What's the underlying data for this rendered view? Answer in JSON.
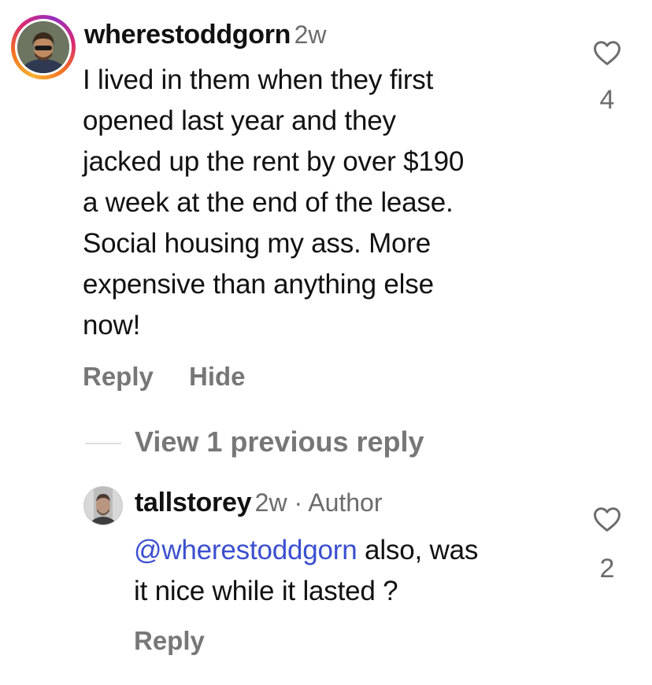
{
  "comment": {
    "username": "wherestoddgorn",
    "time": "2w",
    "text_lines": [
      "I lived in them when they first",
      "opened last year and they",
      "jacked up the rent by over $190",
      "a week at the end of the lease.",
      "Social housing my ass. More",
      "expensive than anything else",
      "now!"
    ],
    "actions": {
      "reply": "Reply",
      "hide": "Hide"
    },
    "likes": "4",
    "icons": {
      "avatar": "user-avatar",
      "like": "heart-outline-icon"
    }
  },
  "view_replies": {
    "label": "View 1 previous reply"
  },
  "reply": {
    "username": "tallstorey",
    "time": "2w",
    "separator": " · ",
    "badge": "Author",
    "mention": "@wherestoddgorn",
    "text_line1_rest": " also, was",
    "text_line2": "it nice while it lasted ?",
    "actions": {
      "reply": "Reply"
    },
    "likes": "2",
    "icons": {
      "avatar": "user-avatar",
      "like": "heart-outline-icon"
    }
  },
  "colors": {
    "text": "#111111",
    "secondary": "#6b6b6b",
    "action": "#777777",
    "mention": "#3b4fd0",
    "story_ring": [
      "#f9b233",
      "#f37021",
      "#d62976",
      "#962fbf"
    ]
  }
}
